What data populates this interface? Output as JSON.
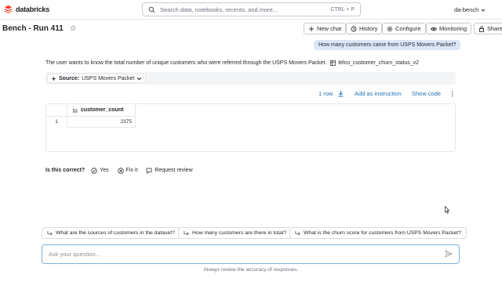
{
  "app": {
    "logo_text": "databricks",
    "brand_color": "#ff3621"
  },
  "topbar": {
    "search_placeholder": "Search data, notebooks, recents, and more...",
    "search_shortcut": "CTRL + P",
    "workspace": "da-bench"
  },
  "header": {
    "title": "Bench - Run 411",
    "buttons": {
      "new_chat": "New chat",
      "history": "History",
      "configure": "Configure",
      "monitoring": "Monitoring",
      "share": "Share"
    }
  },
  "conversation": {
    "user_message": "How many customers came from USPS Movers Packet?",
    "answer_text": "The user wants to know the total number of unique customers who were referred through the USPS Movers Packet.",
    "table_ref": "telco_customer_churn_status_v2",
    "source_label": "Source:",
    "source_value": "USPS Movers Packet",
    "toolbar": {
      "row_count": "1 row",
      "add_instruction": "Add as instruction",
      "show_code": "Show code"
    },
    "result": {
      "columns": [
        "customer_count"
      ],
      "rows": [
        [
          "1",
          "2375"
        ]
      ]
    },
    "feedback": {
      "question": "Is this correct?",
      "yes": "Yes",
      "fix": "Fix it",
      "review": "Request review"
    }
  },
  "suggestions": [
    "What are the sources of customers in the dataset?",
    "How many customers are there in total?",
    "What is the churn score for customers from USPS Movers Packet?"
  ],
  "chat_input": {
    "placeholder": "Ask your question...",
    "disclaimer": "Always review the accuracy of responses."
  }
}
